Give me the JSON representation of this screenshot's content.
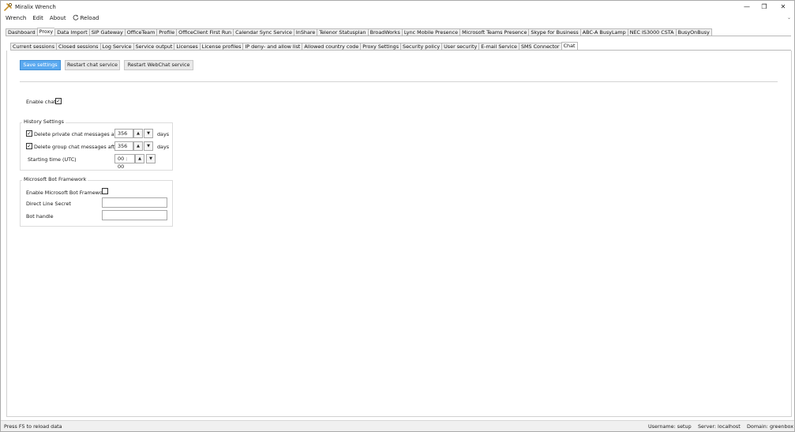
{
  "window": {
    "title": "Miralix Wrench",
    "controls": {
      "minimize": "—",
      "restore": "❐",
      "close": "✕"
    }
  },
  "menu": {
    "items": [
      "Wrench",
      "Edit",
      "About"
    ],
    "reload": "Reload"
  },
  "main_tabs": [
    "Dashboard",
    "Proxy",
    "Data Import",
    "SIP Gateway",
    "OfficeTeam",
    "Profile",
    "OfficeClient First Run",
    "Calendar Sync Service",
    "InShare",
    "Telenor Statusplan",
    "BroadWorks",
    "Lync Mobile Presence",
    "Microsoft Teams Presence",
    "Skype for Business",
    "ABC-A BusyLamp",
    "NEC IS3000 CSTA",
    "BusyOnBusy"
  ],
  "main_tab_active": "Proxy",
  "sub_tabs": [
    "Current sessions",
    "Closed sessions",
    "Log Service",
    "Service output",
    "Licenses",
    "License profiles",
    "IP deny- and allow list",
    "Allowed country code",
    "Proxy Settings",
    "Security policy",
    "User security",
    "E-mail Service",
    "SMS Connector",
    "Chat"
  ],
  "sub_tab_active": "Chat",
  "toolbar": {
    "save": "Save settings",
    "restart_chat": "Restart chat service",
    "restart_webchat": "Restart WebChat service"
  },
  "chat": {
    "enable_label": "Enable chat",
    "enable_checked": true
  },
  "history": {
    "title": "History Settings",
    "private_label": "Delete private chat messages after",
    "private_checked": true,
    "private_value": "356",
    "group_label": "Delete group chat messages after",
    "group_checked": true,
    "group_value": "356",
    "days_unit": "days",
    "start_label": "Starting time (UTC)",
    "start_value": "00 : 00"
  },
  "bot": {
    "title": "Microsoft Bot Framework",
    "enable_label": "Enable Microsoft Bot Framework",
    "enable_checked": false,
    "secret_label": "Direct Line Secret",
    "secret_value": "",
    "handle_label": "Bot handle",
    "handle_value": ""
  },
  "status": {
    "hint": "Press F5 to reload data",
    "username": "Username: setup",
    "server": "Server: localhost",
    "domain": "Domain: greenbox"
  },
  "icons": {
    "app": "wrench-icon",
    "reload": "reload-icon",
    "spin_up": "▲",
    "spin_down": "▼",
    "check": "✓"
  },
  "colors": {
    "primary_button": "#5aa9f0",
    "tab_border": "#b9b9b9"
  }
}
